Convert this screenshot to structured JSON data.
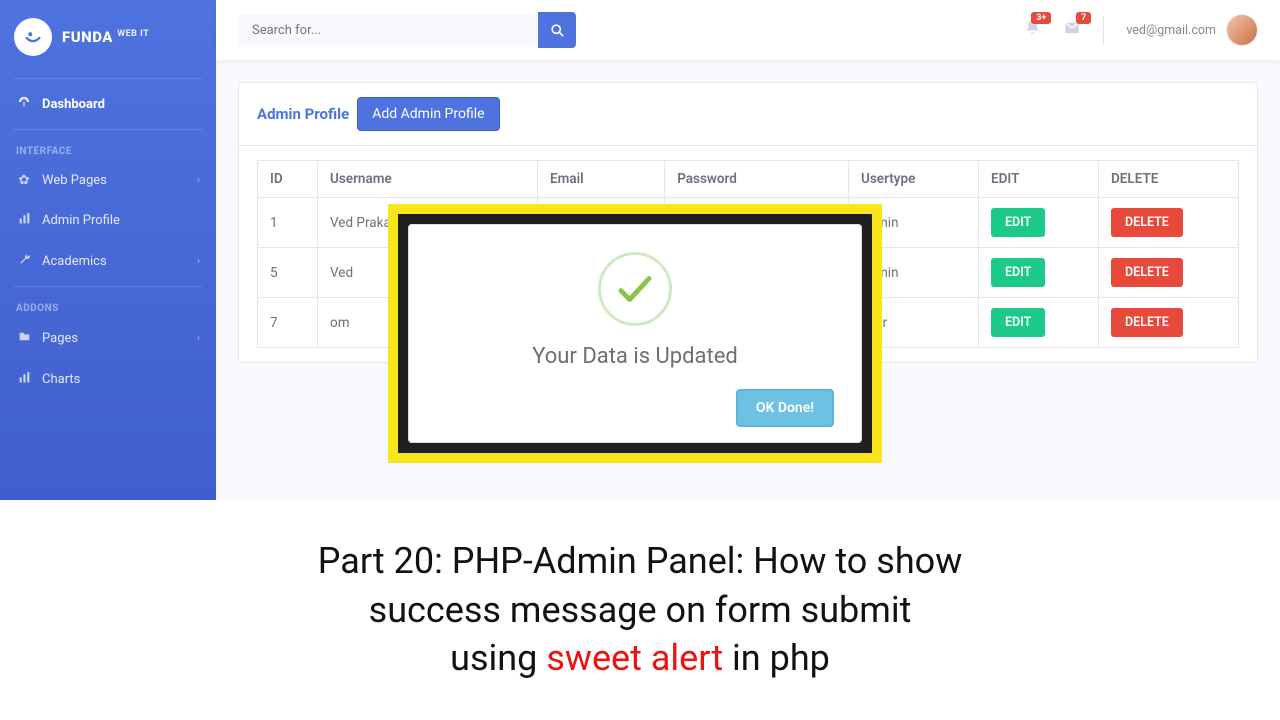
{
  "brand": {
    "name": "FUNDA",
    "sup": "WEB IT"
  },
  "sidebar": {
    "items": [
      {
        "icon": "dash",
        "label": "Dashboard",
        "active": true
      },
      {
        "heading": "INTERFACE"
      },
      {
        "icon": "gear",
        "label": "Web Pages",
        "expand": true
      },
      {
        "icon": "chart",
        "label": "Admin Profile"
      },
      {
        "icon": "wrench",
        "label": "Academics",
        "expand": true
      },
      {
        "heading": "ADDONS"
      },
      {
        "icon": "folder",
        "label": "Pages",
        "expand": true
      },
      {
        "icon": "chart",
        "label": "Charts"
      }
    ]
  },
  "topbar": {
    "search_placeholder": "Search for...",
    "bell_badge": "3+",
    "mail_badge": "7",
    "user_label": "ved@gmail.com"
  },
  "card": {
    "title": "Admin Profile",
    "add_label": "Add Admin Profile",
    "columns": [
      "ID",
      "Username",
      "Email",
      "Password",
      "Usertype",
      "EDIT",
      "DELETE"
    ],
    "rows": [
      {
        "id": "1",
        "username": "Ved Prakash N",
        "usertype": "admin"
      },
      {
        "id": "5",
        "username": "Ved",
        "usertype": "admin"
      },
      {
        "id": "7",
        "username": "om",
        "usertype": "user"
      }
    ],
    "edit_label": "EDIT",
    "delete_label": "DELETE"
  },
  "modal": {
    "title": "Your Data is Updated",
    "ok_label": "OK Done!"
  },
  "caption": {
    "line1": "Part 20: PHP-Admin Panel: How to show",
    "line2": "success message on form submit",
    "line3a": "using ",
    "line3_red": "sweet alert",
    "line3b": " in php"
  }
}
